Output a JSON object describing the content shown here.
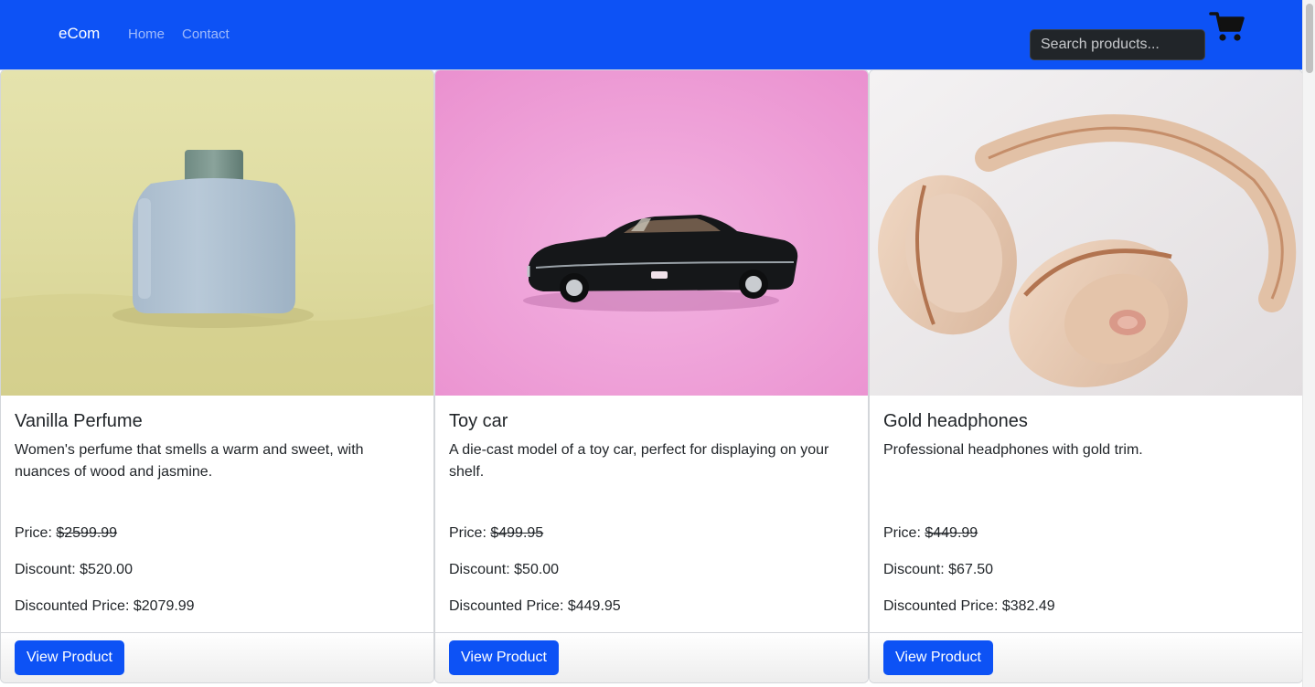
{
  "navbar": {
    "brand": "eCom",
    "links": [
      "Home",
      "Contact"
    ],
    "search_placeholder": "Search products...",
    "cart_icon": "shopping-cart-icon",
    "background_color": "#0d52f5"
  },
  "products": [
    {
      "title": "Vanilla Perfume",
      "description": "Women's perfume that smells a warm and sweet, with nuances of wood and jasmine.",
      "price_label": "Price: ",
      "price": "$2599.99",
      "discount_label": "Discount: ",
      "discount": "$520.00",
      "discounted_label": "Discounted Price: ",
      "discounted_price": "$2079.99",
      "button_label": "View Product"
    },
    {
      "title": "Toy car",
      "description": "A die-cast model of a toy car, perfect for displaying on your shelf.",
      "price_label": "Price: ",
      "price": "$499.95",
      "discount_label": "Discount: ",
      "discount": "$50.00",
      "discounted_label": "Discounted Price: ",
      "discounted_price": "$449.95",
      "button_label": "View Product"
    },
    {
      "title": "Gold headphones",
      "description": "Professional headphones with gold trim.",
      "price_label": "Price: ",
      "price": "$449.99",
      "discount_label": "Discount: ",
      "discount": "$67.50",
      "discounted_label": "Discounted Price: ",
      "discounted_price": "$382.49",
      "button_label": "View Product"
    }
  ],
  "colors": {
    "primary": "#0d52f5",
    "search_bg": "#212529"
  }
}
